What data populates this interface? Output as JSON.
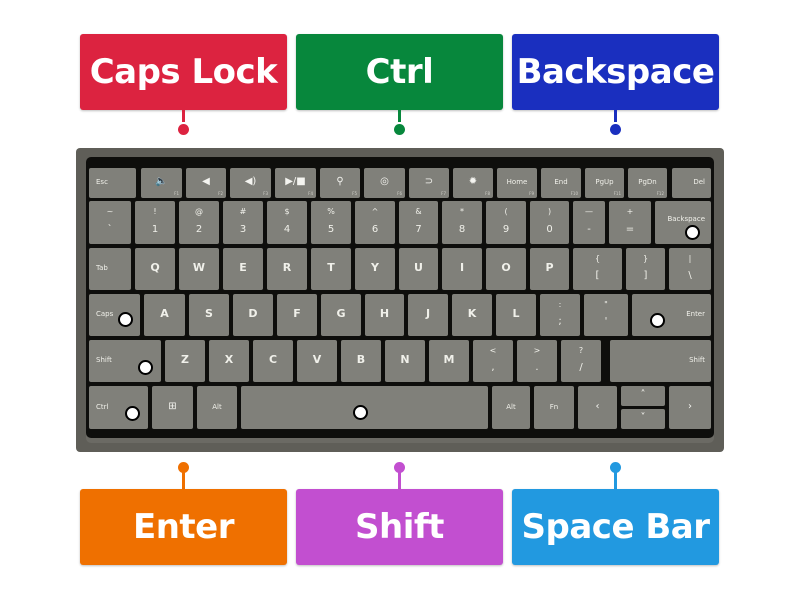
{
  "labels": {
    "top": [
      {
        "text": "Caps Lock",
        "color": "#dc2340"
      },
      {
        "text": "Ctrl",
        "color": "#07873c"
      },
      {
        "text": "Backspace",
        "color": "#1a2fbf"
      }
    ],
    "bottom": [
      {
        "text": "Enter",
        "color": "#ef7000"
      },
      {
        "text": "Shift",
        "color": "#c24fd0"
      },
      {
        "text": "Space Bar",
        "color": "#2299e0"
      }
    ]
  },
  "keyboard": {
    "row0": [
      {
        "label": "Esc"
      },
      {
        "icon": "mute-icon",
        "glyph": "🔈",
        "fn": "F1"
      },
      {
        "icon": "volume-down-icon",
        "glyph": "◀",
        "fn": "F2"
      },
      {
        "icon": "volume-up-icon",
        "glyph": "◀)",
        "fn": "F3"
      },
      {
        "icon": "play-pause-icon",
        "glyph": "▶/■",
        "fn": "F4"
      },
      {
        "icon": "search-icon",
        "glyph": "⚲",
        "fn": "F5"
      },
      {
        "icon": "share-icon",
        "glyph": "◎",
        "fn": "F6"
      },
      {
        "icon": "devices-icon",
        "glyph": "⊃",
        "fn": "F7"
      },
      {
        "icon": "settings-icon",
        "glyph": "✹",
        "fn": "F8"
      },
      {
        "label": "Home",
        "fn": "F9"
      },
      {
        "label": "End",
        "fn": "F10"
      },
      {
        "label": "PgUp",
        "fn": "F11"
      },
      {
        "label": "PgDn",
        "fn": "F12"
      },
      {
        "label": "Del"
      }
    ],
    "row1": [
      {
        "top": "~",
        "bottom": "`"
      },
      {
        "top": "!",
        "bottom": "1"
      },
      {
        "top": "@",
        "bottom": "2"
      },
      {
        "top": "#",
        "bottom": "3"
      },
      {
        "top": "$",
        "bottom": "4"
      },
      {
        "top": "%",
        "bottom": "5"
      },
      {
        "top": "^",
        "bottom": "6"
      },
      {
        "top": "&",
        "bottom": "7"
      },
      {
        "top": "*",
        "bottom": "8"
      },
      {
        "top": "(",
        "bottom": "9"
      },
      {
        "top": ")",
        "bottom": "0"
      },
      {
        "top": "—",
        "bottom": "-"
      },
      {
        "top": "+",
        "bottom": "="
      },
      {
        "label": "Backspace"
      }
    ],
    "row2": [
      {
        "label": "Tab"
      },
      {
        "main": "Q"
      },
      {
        "main": "W"
      },
      {
        "main": "E"
      },
      {
        "main": "R"
      },
      {
        "main": "T"
      },
      {
        "main": "Y"
      },
      {
        "main": "U"
      },
      {
        "main": "I"
      },
      {
        "main": "O"
      },
      {
        "main": "P"
      },
      {
        "top": "{",
        "bottom": "["
      },
      {
        "top": "}",
        "bottom": "]"
      },
      {
        "top": "|",
        "bottom": "\\"
      }
    ],
    "row3": [
      {
        "label": "Caps"
      },
      {
        "main": "A"
      },
      {
        "main": "S"
      },
      {
        "main": "D"
      },
      {
        "main": "F"
      },
      {
        "main": "G"
      },
      {
        "main": "H"
      },
      {
        "main": "J"
      },
      {
        "main": "K"
      },
      {
        "main": "L"
      },
      {
        "top": ":",
        "bottom": ";"
      },
      {
        "top": "\"",
        "bottom": "'"
      },
      {
        "label": "Enter"
      }
    ],
    "row4": [
      {
        "label": "Shift"
      },
      {
        "main": "Z"
      },
      {
        "main": "X"
      },
      {
        "main": "C"
      },
      {
        "main": "V"
      },
      {
        "main": "B"
      },
      {
        "main": "N"
      },
      {
        "main": "M"
      },
      {
        "top": "<",
        "bottom": ","
      },
      {
        "top": ">",
        "bottom": "."
      },
      {
        "top": "?",
        "bottom": "/"
      },
      {
        "label": "Shift"
      }
    ],
    "row5": [
      {
        "label": "Ctrl"
      },
      {
        "icon": "windows-icon",
        "glyph": "⊞"
      },
      {
        "label": "Alt"
      },
      {
        "label": ""
      },
      {
        "label": "Alt"
      },
      {
        "label": "Fn"
      },
      {
        "glyph": "‹"
      },
      {
        "glyph": "˄"
      },
      {
        "glyph": "˅"
      },
      {
        "glyph": "›"
      }
    ]
  }
}
